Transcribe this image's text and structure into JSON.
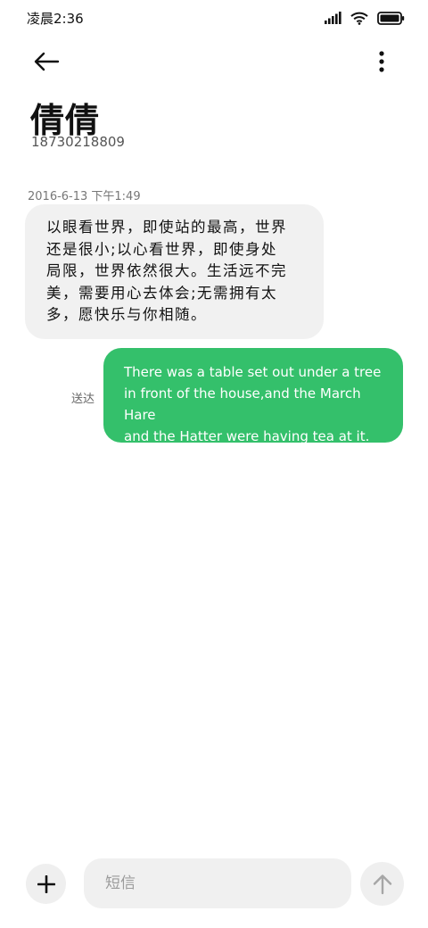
{
  "status_bar": {
    "time": "凌晨2:36",
    "icons": [
      "signal-icon",
      "wifi-icon",
      "battery-icon"
    ]
  },
  "header": {
    "back_icon": "arrow-left-icon",
    "more_icon": "more-vertical-icon",
    "contact_name": "倩倩",
    "contact_number": "18730218809"
  },
  "conversation": {
    "timestamp": "2016-6-13 下午1:49",
    "messages": [
      {
        "direction": "incoming",
        "lines": [
          "以眼看世界，即使站的最高，世界",
          "还是很小;以心看世界，即使身处",
          "局限，世界依然很大。生活远不完",
          "美，需要用心去体会;无需拥有太",
          "多，愿快乐与你相随。"
        ]
      },
      {
        "direction": "outgoing",
        "status": "送达",
        "lines": [
          "There was a table set out under a tree",
          "in front of the house,and the March Hare",
          "and the Hatter were having tea at it."
        ]
      }
    ]
  },
  "composer": {
    "add_icon": "plus-icon",
    "placeholder": "短信",
    "send_icon": "arrow-up-icon"
  },
  "colors": {
    "outgoing_bubble": "#34c06b",
    "incoming_bubble": "#f1f1f1",
    "background": "#ffffff"
  }
}
